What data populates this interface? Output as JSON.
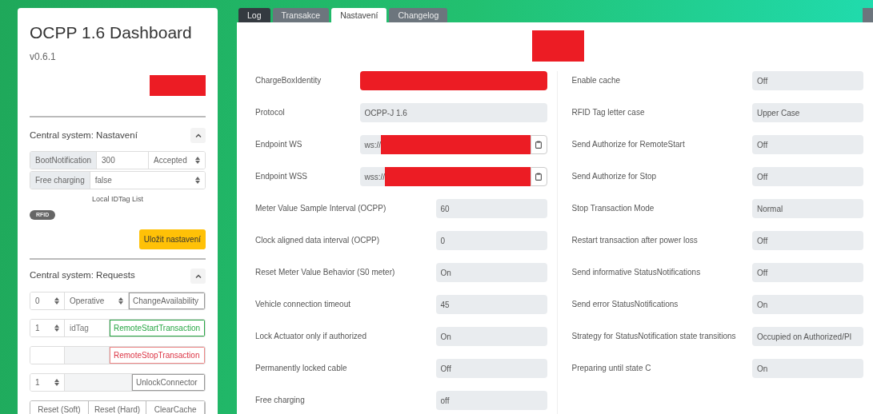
{
  "sidebar": {
    "title": "OCPP 1.6 Dashboard",
    "version": "v0.6.1",
    "settings_section": {
      "title": "Central system: Nastavení",
      "expanded": true,
      "boot_notification": {
        "label": "BootNotification",
        "interval": "300",
        "status": "Accepted"
      },
      "free_charging": {
        "label": "Free charging",
        "value": "false"
      },
      "idtag_list_label": "Local IDTag List",
      "rfid_badge": "RFID",
      "save_button": "Uložit nastavení"
    },
    "requests_section": {
      "title": "Central system: Requests",
      "expanded": true,
      "change_availability": {
        "connector": "0",
        "availability": "Operative",
        "button": "ChangeAvailability"
      },
      "remote_start": {
        "connector": "1",
        "placeholder": "idTag",
        "button": "RemoteStartTransaction"
      },
      "remote_stop": {
        "button": "RemoteStopTransaction"
      },
      "unlock": {
        "connector": "1",
        "button": "UnlockConnector"
      },
      "reset_buttons": [
        "Reset (Soft)",
        "Reset (Hard)",
        "ClearCache"
      ]
    }
  },
  "tabs": [
    {
      "label": "Log",
      "selected": false,
      "color": "#343a40"
    },
    {
      "label": "Transakce",
      "selected": false,
      "color": "#6c757d"
    },
    {
      "label": "Nastavení",
      "selected": true
    },
    {
      "label": "Changelog",
      "selected": false,
      "color": "#6c757d"
    }
  ],
  "settings": {
    "left": [
      {
        "label": "ChargeBoxIdentity",
        "kind": "wide",
        "redacted": true
      },
      {
        "label": "Protocol",
        "kind": "wide",
        "value": "OCPP-J 1.6"
      },
      {
        "label": "Endpoint WS",
        "kind": "url",
        "value": "ws://",
        "redacted": true
      },
      {
        "label": "Endpoint WSS",
        "kind": "url",
        "value": "wss://",
        "redacted": true
      },
      {
        "label": "Meter Value Sample Interval (OCPP)",
        "kind": "setting",
        "value": "60"
      },
      {
        "label": "Clock aligned data interval (OCPP)",
        "kind": "setting",
        "value": "0"
      },
      {
        "label": "Reset Meter Value Behavior (S0 meter)",
        "kind": "setting",
        "value": "On"
      },
      {
        "label": "Vehicle connection timeout",
        "kind": "setting",
        "value": "45"
      },
      {
        "label": "Lock Actuator only if authorized",
        "kind": "setting",
        "value": "On"
      },
      {
        "label": "Permanently locked cable",
        "kind": "setting",
        "value": "Off"
      },
      {
        "label": "Free charging",
        "kind": "setting",
        "value": "off"
      }
    ],
    "right": [
      {
        "label": "Enable cache",
        "kind": "setting",
        "value": "Off"
      },
      {
        "label": "RFID Tag letter case",
        "kind": "setting",
        "value": "Upper Case"
      },
      {
        "label": "Send Authorize for RemoteStart",
        "kind": "setting",
        "value": "Off"
      },
      {
        "label": "Send Authorize for Stop",
        "kind": "setting",
        "value": "Off"
      },
      {
        "label": "Stop Transaction Mode",
        "kind": "setting",
        "value": "Normal"
      },
      {
        "label": "Restart transaction after power loss",
        "kind": "setting",
        "value": "Off"
      },
      {
        "label": "Send informative StatusNotifications",
        "kind": "setting",
        "value": "Off"
      },
      {
        "label": "Send error StatusNotifications",
        "kind": "setting",
        "value": "On"
      },
      {
        "label": "Strategy for StatusNotification state transitions",
        "kind": "setting",
        "value": "Occupied on Authorized/Pl"
      },
      {
        "label": "Preparing until state C",
        "kind": "setting",
        "value": "On"
      }
    ]
  }
}
